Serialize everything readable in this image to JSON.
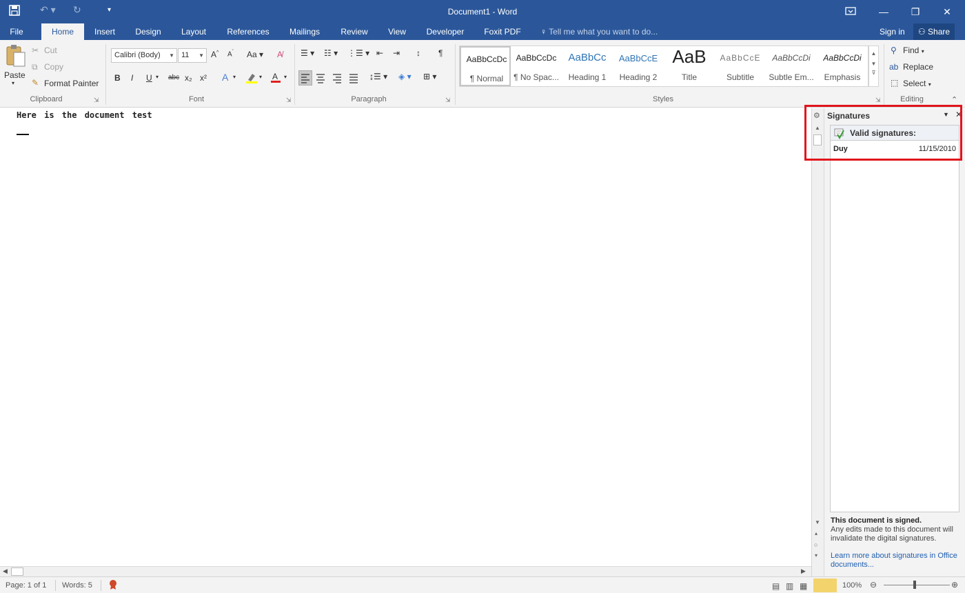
{
  "titlebar": {
    "title": "Document1 - Word",
    "icons": [
      "save-icon",
      "undo-icon",
      "redo-icon",
      "customize-qat-icon",
      "ribbon-display-icon",
      "minimize-icon",
      "restore-icon",
      "close-icon"
    ]
  },
  "tabs": {
    "file": "File",
    "home": "Home",
    "insert": "Insert",
    "design": "Design",
    "layout": "Layout",
    "references": "References",
    "mailings": "Mailings",
    "review": "Review",
    "view": "View",
    "developer": "Developer",
    "foxit": "Foxit PDF",
    "tell_me": "Tell me what you want to do...",
    "sign_in": "Sign in",
    "share": "Share"
  },
  "ribbon": {
    "clipboard": {
      "paste": "Paste",
      "cut": "Cut",
      "copy": "Copy",
      "format_painter": "Format Painter",
      "label": "Clipboard"
    },
    "font": {
      "name": "Calibri (Body)",
      "size": "11",
      "label": "Font",
      "case": "Aa",
      "bold": "B",
      "italic": "I",
      "underline": "U",
      "strike": "abc",
      "sub": "x₂",
      "sup": "x²"
    },
    "paragraph": {
      "label": "Paragraph",
      "pilcrow": "¶"
    },
    "styles": {
      "label": "Styles",
      "items": [
        {
          "sample": "AaBbCcDc",
          "name": "¶ Normal"
        },
        {
          "sample": "AaBbCcDc",
          "name": "¶ No Spac..."
        },
        {
          "sample": "AaBbCc",
          "name": "Heading 1"
        },
        {
          "sample": "AaBbCcE",
          "name": "Heading 2"
        },
        {
          "sample": "AaB",
          "name": "Title"
        },
        {
          "sample": "AaBbCcE",
          "name": "Subtitle"
        },
        {
          "sample": "AaBbCcDi",
          "name": "Subtle Em..."
        },
        {
          "sample": "AaBbCcDi",
          "name": "Emphasis"
        }
      ]
    },
    "editing": {
      "find": "Find",
      "replace": "Replace",
      "select": "Select",
      "label": "Editing"
    }
  },
  "document": {
    "text": "Here is the document test"
  },
  "signatures": {
    "title": "Signatures",
    "valid_header": "Valid signatures:",
    "signer": "Duy",
    "date": "11/15/2010",
    "status_bold": "This document is signed.",
    "status_text": "Any edits made to this document will invalidate the digital signatures.",
    "learn_more": "Learn more about signatures in Office documents..."
  },
  "statusbar": {
    "page": "Page: 1 of 1",
    "words": "Words: 5",
    "zoom": "100%"
  },
  "colors": {
    "brand": "#2b579a",
    "highlight_box": "#e2141c",
    "ribbon_bg": "#f3f3f3",
    "link": "#1f5fb0"
  }
}
